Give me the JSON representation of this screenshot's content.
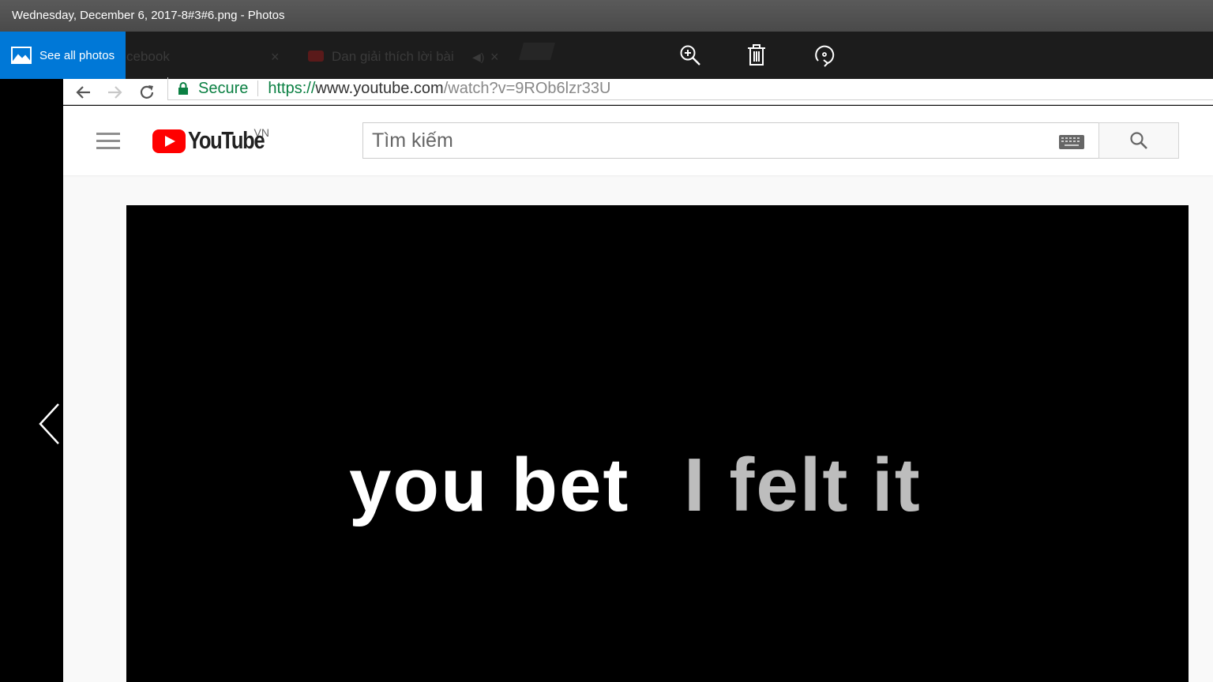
{
  "window": {
    "title": "Wednesday, December 6, 2017-8#3#6.png - Photos"
  },
  "toolbar": {
    "see_all_label": "See all photos",
    "buttons": [
      {
        "name": "zoom-in",
        "icon": "zoom-in-icon"
      },
      {
        "name": "delete",
        "icon": "trash-icon"
      },
      {
        "name": "rotate",
        "icon": "rotate-icon"
      }
    ]
  },
  "browser": {
    "tabs": [
      {
        "label": "cebook"
      },
      {
        "label": "Dan giải thích lời bài"
      }
    ],
    "secure_label": "Secure",
    "url_scheme": "https://",
    "url_host": "www.youtube.com",
    "url_path": "/watch?v=9ROb6lzr33U"
  },
  "youtube": {
    "logo_text": "YouTube",
    "country_code": "VN",
    "search_placeholder": "Tìm kiếm"
  },
  "video": {
    "caption_white": "you bet",
    "caption_gray": "I felt it"
  },
  "colors": {
    "accent": "#0078d7",
    "youtube_red": "#ff0000",
    "secure_green": "#0b8043"
  }
}
